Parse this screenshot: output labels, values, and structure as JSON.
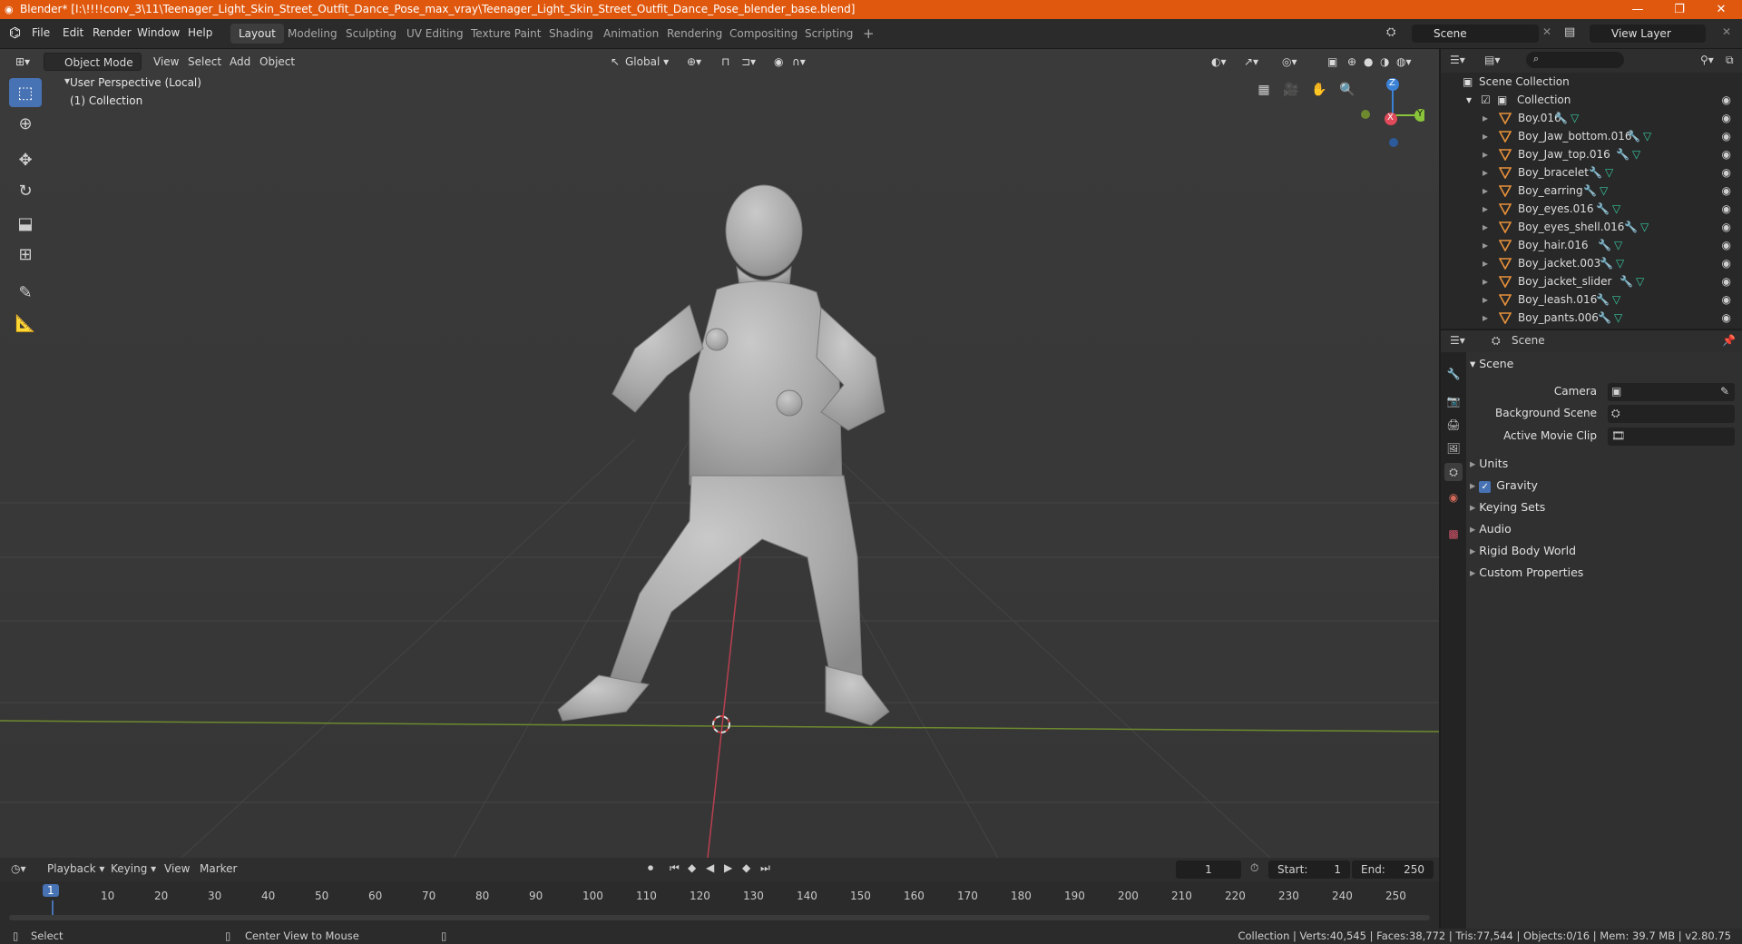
{
  "window": {
    "title": "Blender* [I:\\!!!!conv_3\\11\\Teenager_Light_Skin_Street_Outfit_Dance_Pose_max_vray\\Teenager_Light_Skin_Street_Outfit_Dance_Pose_blender_base.blend]",
    "minimize": "—",
    "restore": "❐",
    "close": "✕"
  },
  "menu": [
    "File",
    "Edit",
    "Render",
    "Window",
    "Help"
  ],
  "workspaces": [
    "Layout",
    "Modeling",
    "Sculpting",
    "UV Editing",
    "Texture Paint",
    "Shading",
    "Animation",
    "Rendering",
    "Compositing",
    "Scripting"
  ],
  "add_workspace": "+",
  "scene_field": "Scene",
  "view_layer_field": "View Layer",
  "viewport": {
    "mode": "Object Mode",
    "menus": [
      "View",
      "Select",
      "Add",
      "Object"
    ],
    "transform_orientation": "Global",
    "perspective_label": "User Perspective (Local)",
    "collection_label": "(1) Collection",
    "gizmo": {
      "z": "Z",
      "x": "X",
      "y": "Y"
    }
  },
  "outliner": {
    "root": "Scene Collection",
    "collection": "Collection",
    "items": [
      "Boy.016",
      "Boy_Jaw_bottom.016",
      "Boy_Jaw_top.016",
      "Boy_bracelet",
      "Boy_earring",
      "Boy_eyes.016",
      "Boy_eyes_shell.016",
      "Boy_hair.016",
      "Boy_jacket.003",
      "Boy_jacket_slider",
      "Boy_leash.016",
      "Boy_pants.006"
    ]
  },
  "properties": {
    "context": "Scene",
    "panel_title": "Scene",
    "camera_label": "Camera",
    "background_scene_label": "Background Scene",
    "active_movie_clip_label": "Active Movie Clip",
    "subpanels": [
      "Units",
      "Gravity",
      "Keying Sets",
      "Audio",
      "Rigid Body World",
      "Custom Properties"
    ],
    "gravity_checked": true
  },
  "timeline": {
    "menus": [
      "Playback",
      "Keying",
      "View",
      "Marker"
    ],
    "current_frame": "1",
    "start_label": "Start:",
    "start_value": "1",
    "end_label": "End:",
    "end_value": "250",
    "ticks": [
      "1",
      "10",
      "20",
      "30",
      "40",
      "50",
      "60",
      "70",
      "80",
      "90",
      "100",
      "110",
      "120",
      "130",
      "140",
      "150",
      "160",
      "170",
      "180",
      "190",
      "200",
      "210",
      "220",
      "230",
      "240",
      "250"
    ]
  },
  "statusbar": {
    "select": "Select",
    "center_view": "Center View to Mouse",
    "stats": "Collection | Verts:40,545 | Faces:38,772 | Tris:77,544 | Objects:0/16 | Mem: 39.7 MB | v2.80.75"
  },
  "colors": {
    "title_bg": "#e0580e",
    "accent": "#4772b3",
    "x_axis": "#e04a5a",
    "y_axis": "#8ac43a",
    "z_axis": "#3b82d6",
    "mesh_icon": "#36c9a1"
  }
}
